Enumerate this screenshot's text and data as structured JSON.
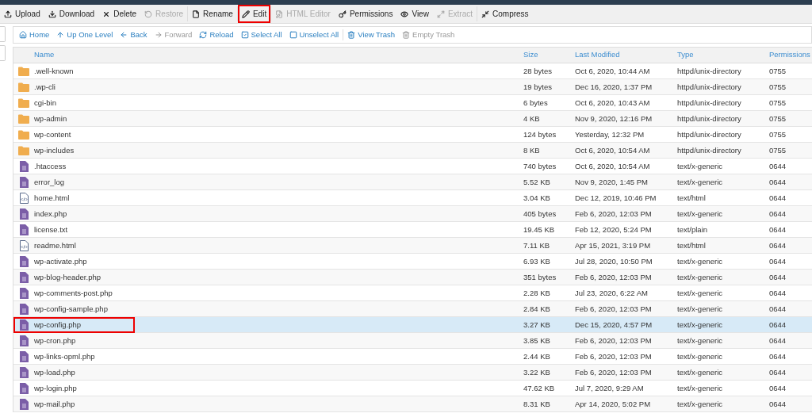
{
  "toolbar": [
    {
      "label": "Upload",
      "disabled": false,
      "annotated": false
    },
    {
      "label": "Download",
      "disabled": false,
      "annotated": false
    },
    {
      "label": "Delete",
      "disabled": false,
      "annotated": false
    },
    {
      "label": "Restore",
      "disabled": true,
      "annotated": false
    },
    {
      "label": "Rename",
      "disabled": false,
      "annotated": false
    },
    {
      "label": "Edit",
      "disabled": false,
      "annotated": true
    },
    {
      "label": "HTML Editor",
      "disabled": true,
      "annotated": false
    },
    {
      "label": "Permissions",
      "disabled": false,
      "annotated": false
    },
    {
      "label": "View",
      "disabled": false,
      "annotated": false
    },
    {
      "label": "Extract",
      "disabled": true,
      "annotated": false
    },
    {
      "label": "Compress",
      "disabled": false,
      "annotated": false
    }
  ],
  "nav": [
    {
      "label": "Home",
      "disabled": false
    },
    {
      "label": "Up One Level",
      "disabled": false
    },
    {
      "label": "Back",
      "disabled": false
    },
    {
      "label": "Forward",
      "disabled": true
    },
    {
      "label": "Reload",
      "disabled": false
    },
    {
      "label": "Select All",
      "disabled": false
    },
    {
      "label": "Unselect All",
      "disabled": false
    },
    {
      "label": "View Trash",
      "disabled": false
    },
    {
      "label": "Empty Trash",
      "disabled": true
    }
  ],
  "table": {
    "columns": [
      "Name",
      "Size",
      "Last Modified",
      "Type",
      "Permissions"
    ],
    "rows": [
      {
        "kind": "folder",
        "name": ".well-known",
        "size": "28 bytes",
        "modified": "Oct 6, 2020, 10:44 AM",
        "type": "httpd/unix-directory",
        "permissions": "0755",
        "selected": false,
        "annotated": false
      },
      {
        "kind": "folder",
        "name": ".wp-cli",
        "size": "19 bytes",
        "modified": "Dec 16, 2020, 1:37 PM",
        "type": "httpd/unix-directory",
        "permissions": "0755",
        "selected": false,
        "annotated": false
      },
      {
        "kind": "folder",
        "name": "cgi-bin",
        "size": "6 bytes",
        "modified": "Oct 6, 2020, 10:43 AM",
        "type": "httpd/unix-directory",
        "permissions": "0755",
        "selected": false,
        "annotated": false
      },
      {
        "kind": "folder",
        "name": "wp-admin",
        "size": "4 KB",
        "modified": "Nov 9, 2020, 12:16 PM",
        "type": "httpd/unix-directory",
        "permissions": "0755",
        "selected": false,
        "annotated": false
      },
      {
        "kind": "folder",
        "name": "wp-content",
        "size": "124 bytes",
        "modified": "Yesterday, 12:32 PM",
        "type": "httpd/unix-directory",
        "permissions": "0755",
        "selected": false,
        "annotated": false
      },
      {
        "kind": "folder",
        "name": "wp-includes",
        "size": "8 KB",
        "modified": "Oct 6, 2020, 10:54 AM",
        "type": "httpd/unix-directory",
        "permissions": "0755",
        "selected": false,
        "annotated": false
      },
      {
        "kind": "file",
        "name": ".htaccess",
        "size": "740 bytes",
        "modified": "Oct 6, 2020, 10:54 AM",
        "type": "text/x-generic",
        "permissions": "0644",
        "selected": false,
        "annotated": false
      },
      {
        "kind": "file",
        "name": "error_log",
        "size": "5.52 KB",
        "modified": "Nov 9, 2020, 1:45 PM",
        "type": "text/x-generic",
        "permissions": "0644",
        "selected": false,
        "annotated": false
      },
      {
        "kind": "html",
        "name": "home.html",
        "size": "3.04 KB",
        "modified": "Dec 12, 2019, 10:46 PM",
        "type": "text/html",
        "permissions": "0644",
        "selected": false,
        "annotated": false
      },
      {
        "kind": "file",
        "name": "index.php",
        "size": "405 bytes",
        "modified": "Feb 6, 2020, 12:03 PM",
        "type": "text/x-generic",
        "permissions": "0644",
        "selected": false,
        "annotated": false
      },
      {
        "kind": "file",
        "name": "license.txt",
        "size": "19.45 KB",
        "modified": "Feb 12, 2020, 5:24 PM",
        "type": "text/plain",
        "permissions": "0644",
        "selected": false,
        "annotated": false
      },
      {
        "kind": "html",
        "name": "readme.html",
        "size": "7.11 KB",
        "modified": "Apr 15, 2021, 3:19 PM",
        "type": "text/html",
        "permissions": "0644",
        "selected": false,
        "annotated": false
      },
      {
        "kind": "file",
        "name": "wp-activate.php",
        "size": "6.93 KB",
        "modified": "Jul 28, 2020, 10:50 PM",
        "type": "text/x-generic",
        "permissions": "0644",
        "selected": false,
        "annotated": false
      },
      {
        "kind": "file",
        "name": "wp-blog-header.php",
        "size": "351 bytes",
        "modified": "Feb 6, 2020, 12:03 PM",
        "type": "text/x-generic",
        "permissions": "0644",
        "selected": false,
        "annotated": false
      },
      {
        "kind": "file",
        "name": "wp-comments-post.php",
        "size": "2.28 KB",
        "modified": "Jul 23, 2020, 6:22 AM",
        "type": "text/x-generic",
        "permissions": "0644",
        "selected": false,
        "annotated": false
      },
      {
        "kind": "file",
        "name": "wp-config-sample.php",
        "size": "2.84 KB",
        "modified": "Feb 6, 2020, 12:03 PM",
        "type": "text/x-generic",
        "permissions": "0644",
        "selected": false,
        "annotated": false
      },
      {
        "kind": "file",
        "name": "wp-config.php",
        "size": "3.27 KB",
        "modified": "Dec 15, 2020, 4:57 PM",
        "type": "text/x-generic",
        "permissions": "0644",
        "selected": true,
        "annotated": true
      },
      {
        "kind": "file",
        "name": "wp-cron.php",
        "size": "3.85 KB",
        "modified": "Feb 6, 2020, 12:03 PM",
        "type": "text/x-generic",
        "permissions": "0644",
        "selected": false,
        "annotated": false
      },
      {
        "kind": "file",
        "name": "wp-links-opml.php",
        "size": "2.44 KB",
        "modified": "Feb 6, 2020, 12:03 PM",
        "type": "text/x-generic",
        "permissions": "0644",
        "selected": false,
        "annotated": false
      },
      {
        "kind": "file",
        "name": "wp-load.php",
        "size": "3.22 KB",
        "modified": "Feb 6, 2020, 12:03 PM",
        "type": "text/x-generic",
        "permissions": "0644",
        "selected": false,
        "annotated": false
      },
      {
        "kind": "file",
        "name": "wp-login.php",
        "size": "47.62 KB",
        "modified": "Jul 7, 2020, 9:29 AM",
        "type": "text/x-generic",
        "permissions": "0644",
        "selected": false,
        "annotated": false
      },
      {
        "kind": "file",
        "name": "wp-mail.php",
        "size": "8.31 KB",
        "modified": "Apr 14, 2020, 5:02 PM",
        "type": "text/x-generic",
        "permissions": "0644",
        "selected": false,
        "annotated": false
      }
    ]
  }
}
